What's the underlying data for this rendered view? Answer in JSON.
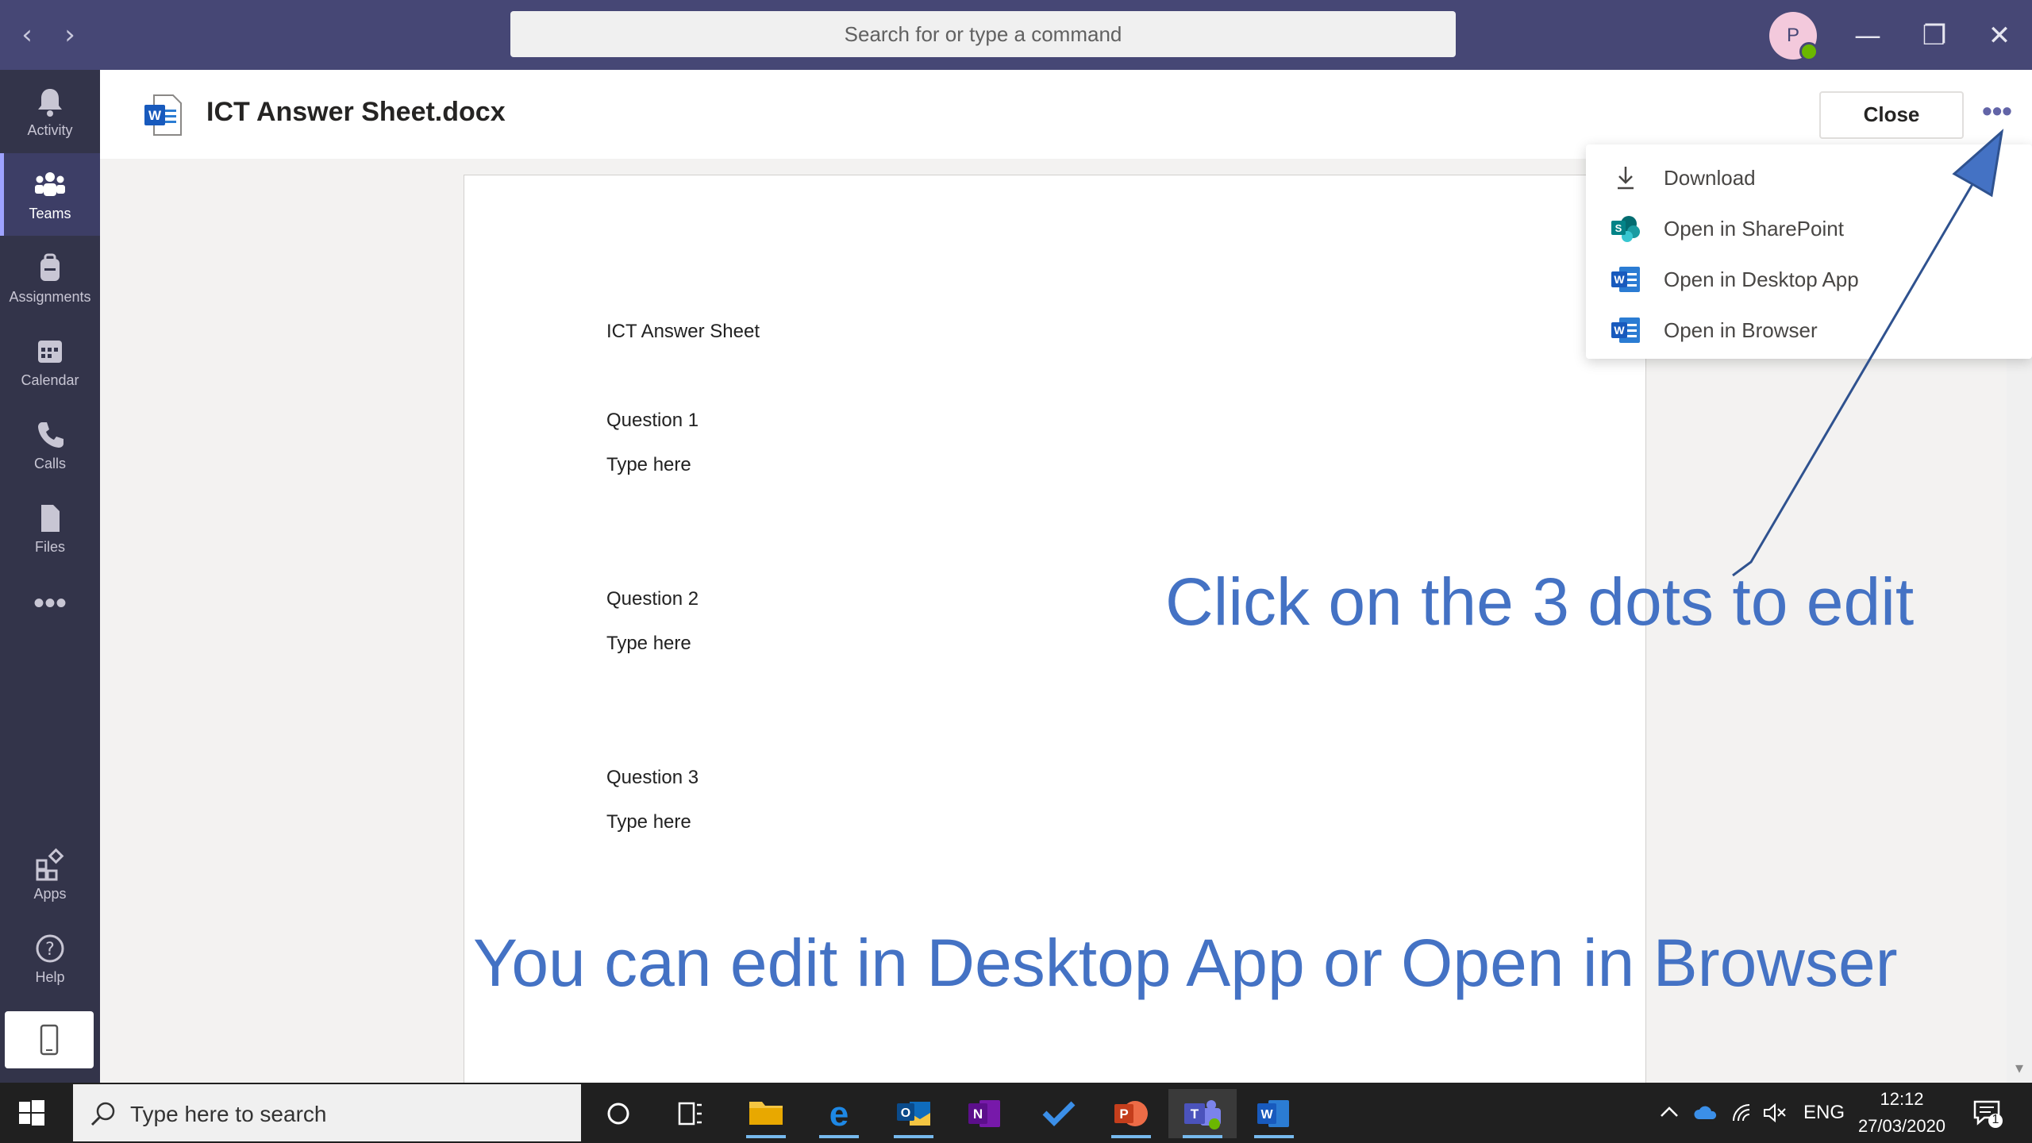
{
  "titlebar": {
    "back": "‹",
    "forward": "›",
    "search_placeholder": "Search for or type a command",
    "avatar_initial": "P",
    "minimize": "—",
    "maximize": "❐",
    "close": "✕"
  },
  "rail": {
    "items": [
      {
        "label": "Activity"
      },
      {
        "label": "Teams"
      },
      {
        "label": "Assignments"
      },
      {
        "label": "Calendar"
      },
      {
        "label": "Calls"
      },
      {
        "label": "Files"
      }
    ],
    "more": "•••",
    "apps": "Apps",
    "help": "Help"
  },
  "header": {
    "title": "ICT Answer Sheet.docx",
    "close_label": "Close",
    "more": "•••"
  },
  "document": {
    "heading": "ICT Answer Sheet",
    "q1": "Question 1",
    "a1": "Type here",
    "q2": "Question 2",
    "a2": "Type here",
    "q3": "Question 3",
    "a3": "Type here"
  },
  "menu": {
    "items": [
      {
        "label": "Download"
      },
      {
        "label": "Open in SharePoint"
      },
      {
        "label": "Open in Desktop App"
      },
      {
        "label": "Open in Browser"
      }
    ]
  },
  "annotations": {
    "dots_hint": "Click on the 3 dots to edit",
    "edit_hint": "You can edit in Desktop App or Open in Browser"
  },
  "taskbar": {
    "search_placeholder": "Type here to search",
    "language": "ENG",
    "time": "12:12",
    "date": "27/03/2020",
    "notification_count": "1"
  },
  "colors": {
    "teams_purple": "#464775",
    "rail": "#33344a",
    "annotation_blue": "#4472c4"
  }
}
